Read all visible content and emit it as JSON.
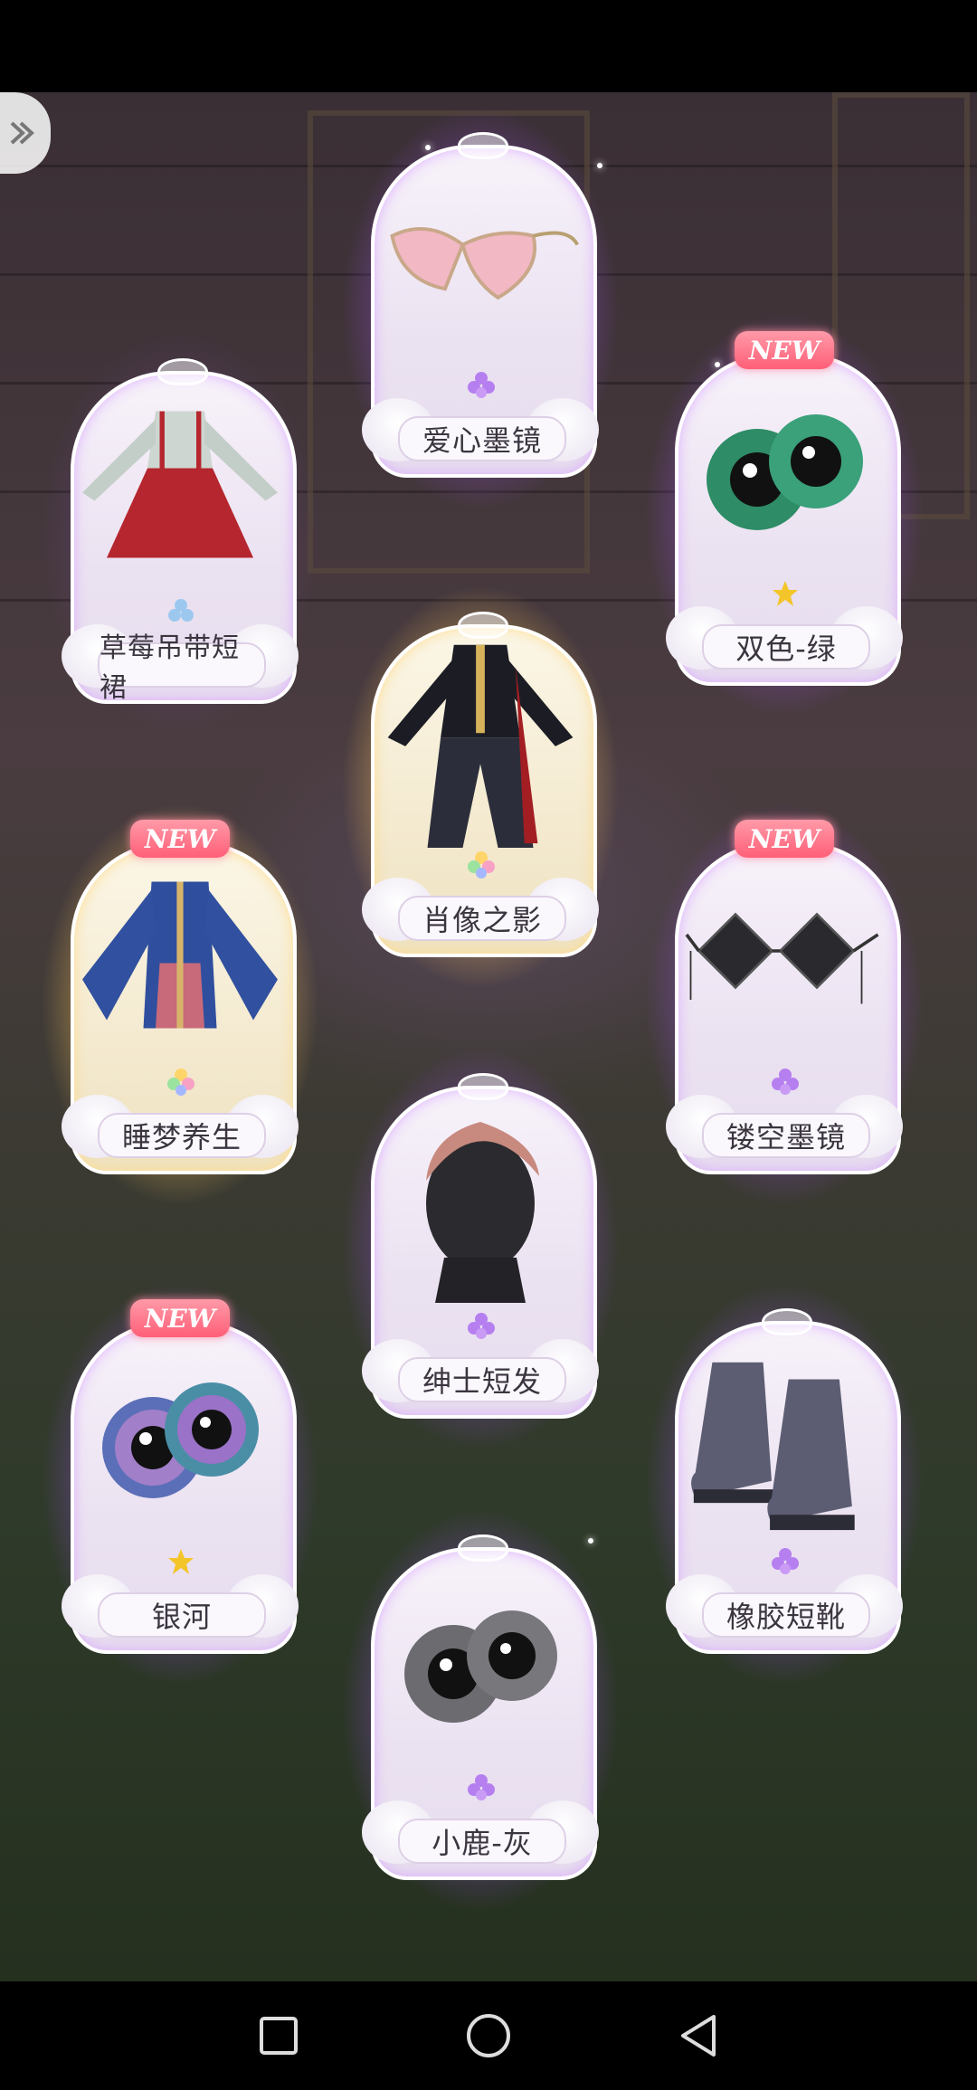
{
  "cards": [
    {
      "id": "glasses-heart",
      "label": "爱心墨镜",
      "is_new": false,
      "frame": "purple",
      "rarity": "purple-flower",
      "item_icon": "heart-sunglasses-icon"
    },
    {
      "id": "dress-strawberry",
      "label": "草莓吊带短裙",
      "is_new": false,
      "frame": "purple",
      "rarity": "blue-flower",
      "item_icon": "strawberry-dress-icon"
    },
    {
      "id": "eyes-green",
      "label": "双色-绿",
      "is_new": true,
      "frame": "purple",
      "rarity": "gold-flower",
      "item_icon": "green-eyes-icon"
    },
    {
      "id": "suit-portrait",
      "label": "肖像之影",
      "is_new": false,
      "frame": "gold",
      "rarity": "rainbow-flower",
      "item_icon": "dark-suit-icon"
    },
    {
      "id": "robe-sleep",
      "label": "睡梦养生",
      "is_new": true,
      "frame": "gold",
      "rarity": "rainbow-flower",
      "item_icon": "blue-robe-icon"
    },
    {
      "id": "glasses-hollow",
      "label": "镂空墨镜",
      "is_new": true,
      "frame": "purple",
      "rarity": "purple-flower",
      "item_icon": "diamond-sunglasses-icon"
    },
    {
      "id": "hair-gentleman",
      "label": "绅士短发",
      "is_new": false,
      "frame": "purple",
      "rarity": "purple-flower",
      "item_icon": "short-hair-icon"
    },
    {
      "id": "eyes-galaxy",
      "label": "银河",
      "is_new": true,
      "frame": "purple",
      "rarity": "gold-flower",
      "item_icon": "galaxy-eyes-icon"
    },
    {
      "id": "boots-rubber",
      "label": "橡胶短靴",
      "is_new": false,
      "frame": "purple",
      "rarity": "purple-flower",
      "item_icon": "rubber-boots-icon"
    },
    {
      "id": "eyes-deer-gray",
      "label": "小鹿-灰",
      "is_new": false,
      "frame": "purple",
      "rarity": "purple-flower",
      "item_icon": "gray-eyes-icon"
    }
  ],
  "new_badge_text": "NEW",
  "nav": {
    "recent_icon": "square-icon",
    "home_icon": "circle-icon",
    "back_icon": "triangle-back-icon"
  },
  "colors": {
    "purple_glow": "#b878ff",
    "gold_glow": "#ffd98c",
    "new_badge": "#ff5f78"
  }
}
